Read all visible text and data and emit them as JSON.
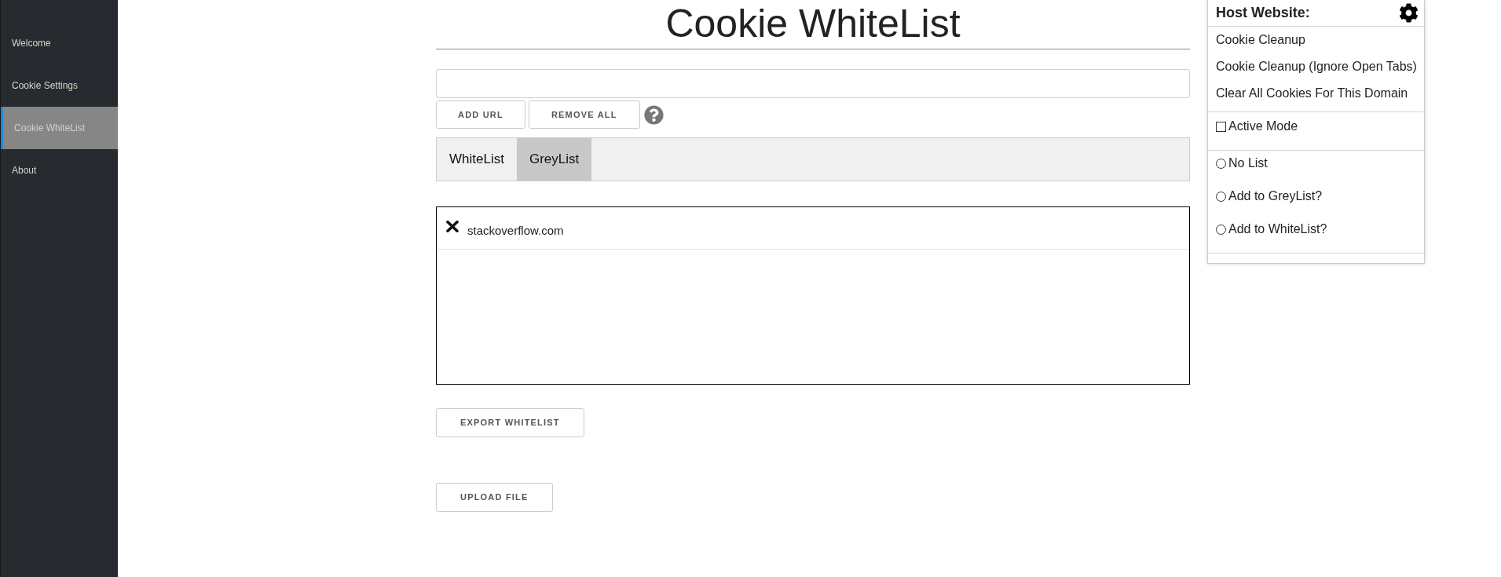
{
  "sidebar": {
    "items": [
      {
        "label": "Welcome",
        "selected": false
      },
      {
        "label": "Cookie Settings",
        "selected": false
      },
      {
        "label": "Cookie WhiteList",
        "selected": true
      },
      {
        "label": "About",
        "selected": false
      }
    ]
  },
  "page": {
    "title": "Cookie WhiteList"
  },
  "url_actions": [
    "ADD URL",
    "REMOVE ALL"
  ],
  "tabs": [
    {
      "label": "WhiteList",
      "selected": false
    },
    {
      "label": "GreyList",
      "selected": true
    }
  ],
  "list": {
    "entries": [
      {
        "domain": "stackoverflow.com"
      }
    ]
  },
  "file_actions": [
    "EXPORT WHITELIST",
    "UPLOAD FILE"
  ],
  "popup": {
    "title": "Host Website:",
    "actions": [
      "Cookie Cleanup",
      "Cookie Cleanup (Ignore Open Tabs)",
      "Clear All Cookies For This Domain"
    ],
    "active_mode": {
      "label": "Active Mode",
      "checked": false
    },
    "list_options": [
      {
        "label": "No List",
        "selected": false
      },
      {
        "label": "Add to GreyList?",
        "selected": false
      },
      {
        "label": "Add to WhiteList?",
        "selected": false
      }
    ]
  }
}
